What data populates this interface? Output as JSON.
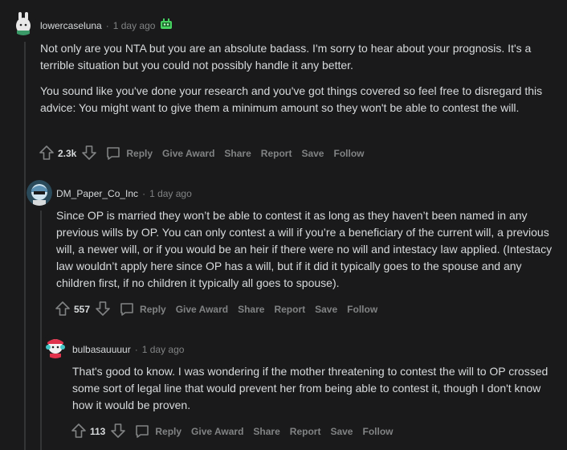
{
  "comments": [
    {
      "username": "lowercaseluna",
      "time": "1 day ago",
      "paragraphs": [
        "Not only are you NTA but you are an absolute badass. I'm sorry to hear about your prognosis. It's a terrible situation but you could not possibly handle it any better.",
        "You sound like you've done your research and you've got things covered so feel free to disregard this advice: You might want to give them a minimum amount so they won't be able to contest the will."
      ],
      "votes": "2.3k"
    },
    {
      "username": "DM_Paper_Co_Inc",
      "time": "1 day ago",
      "paragraphs": [
        "Since OP is married they won’t be able to contest it as long as they haven’t been named in any previous wills by OP. You can only contest a will if you’re a beneficiary of the current will, a previous will, a newer will, or if you would be an heir if there were no will and intestacy law applied. (Intestacy law wouldn’t apply here since OP has a will, but if it did it typically goes to the spouse and any children first, if no children it typically all goes to spouse)."
      ],
      "votes": "557"
    },
    {
      "username": "bulbasauuuur",
      "time": "1 day ago",
      "paragraphs": [
        "That's good to know. I was wondering if the mother threatening to contest the will to OP crossed some sort of legal line that would prevent her from being able to contest it, though I don't know how it would be proven."
      ],
      "votes": "113"
    }
  ],
  "actions": {
    "reply": "Reply",
    "give_award": "Give Award",
    "share": "Share",
    "report": "Report",
    "save": "Save",
    "follow": "Follow"
  },
  "separator": "·",
  "colors": {
    "background": "#1a1a1b",
    "text": "#d7dadc",
    "meta": "#818384",
    "thread_line": "#343536"
  }
}
